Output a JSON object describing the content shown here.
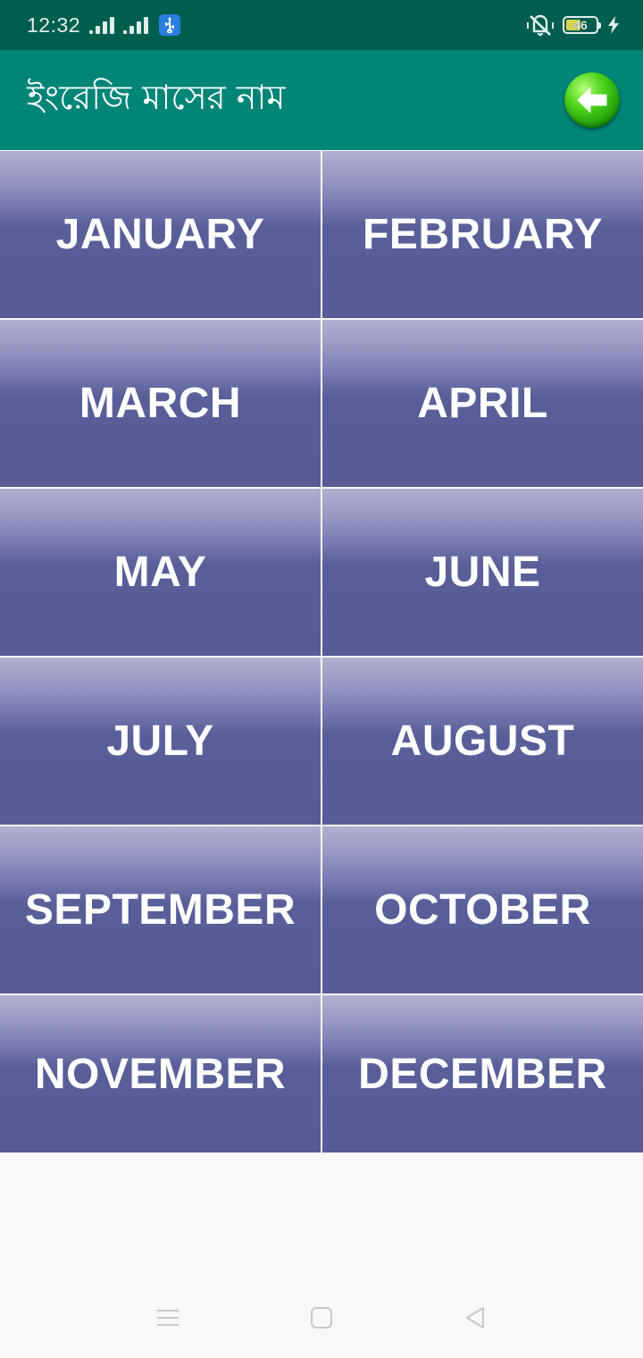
{
  "status_bar": {
    "time": "12:32",
    "battery_level": "46",
    "icons": [
      "signal-icon",
      "signal-icon",
      "usb-icon",
      "vibrate-off-icon",
      "battery-icon",
      "charging-icon"
    ]
  },
  "app_bar": {
    "title": "ইংরেজি মাসের নাম",
    "back_icon": "back-arrow-icon"
  },
  "months": [
    "JANUARY",
    "FEBRUARY",
    "MARCH",
    "APRIL",
    "MAY",
    "JUNE",
    "JULY",
    "AUGUST",
    "SEPTEMBER",
    "OCTOBER",
    "NOVEMBER",
    "DECEMBER"
  ],
  "nav_bar": {
    "icons": [
      "menu-icon",
      "home-icon",
      "back-icon"
    ]
  },
  "colors": {
    "status_bar": "#005e4e",
    "app_bar": "#008577",
    "tile": "#575c96",
    "tile_highlight": "#b0b0d2"
  }
}
